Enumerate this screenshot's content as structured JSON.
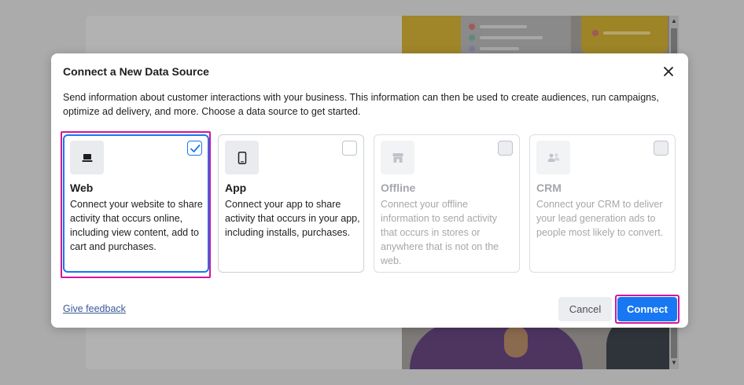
{
  "dialog": {
    "title": "Connect a New Data Source",
    "description": "Send information about customer interactions with your business. This information can then be used to create audiences, run campaigns, optimize ad delivery, and more. Choose a data source to get started."
  },
  "sources": [
    {
      "name": "Web",
      "icon": "laptop-icon",
      "checked": true,
      "enabled": true,
      "description": "Connect your website to share activity that occurs online, including view content, add to cart and purchases."
    },
    {
      "name": "App",
      "icon": "mobile-phone-icon",
      "checked": false,
      "enabled": true,
      "description": "Connect your app to share activity that occurs in your app, including installs, purchases."
    },
    {
      "name": "Offline",
      "icon": "store-icon",
      "checked": false,
      "enabled": false,
      "description": "Connect your offline information to send activity that occurs in stores or anywhere that is not on the web."
    },
    {
      "name": "CRM",
      "icon": "people-icon",
      "checked": false,
      "enabled": false,
      "description": "Connect your CRM to deliver your lead generation ads to people most likely to convert."
    }
  ],
  "footer": {
    "feedback_link": "Give feedback",
    "cancel_label": "Cancel",
    "connect_label": "Connect"
  },
  "colors": {
    "accent": "#1877f2",
    "highlight": "#d4159b",
    "link": "#385898"
  }
}
